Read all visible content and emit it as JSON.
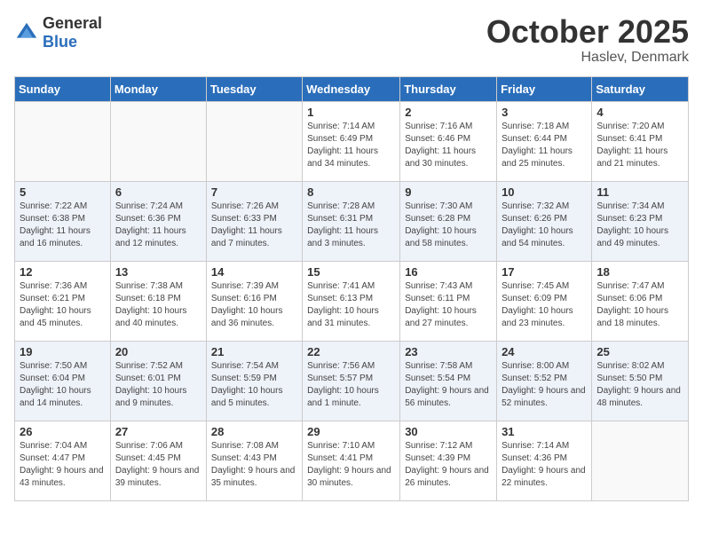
{
  "logo": {
    "text_general": "General",
    "text_blue": "Blue"
  },
  "header": {
    "month": "October 2025",
    "location": "Haslev, Denmark"
  },
  "weekdays": [
    "Sunday",
    "Monday",
    "Tuesday",
    "Wednesday",
    "Thursday",
    "Friday",
    "Saturday"
  ],
  "weeks": [
    [
      {
        "day": "",
        "sunrise": "",
        "sunset": "",
        "daylight": ""
      },
      {
        "day": "",
        "sunrise": "",
        "sunset": "",
        "daylight": ""
      },
      {
        "day": "",
        "sunrise": "",
        "sunset": "",
        "daylight": ""
      },
      {
        "day": "1",
        "sunrise": "Sunrise: 7:14 AM",
        "sunset": "Sunset: 6:49 PM",
        "daylight": "Daylight: 11 hours and 34 minutes."
      },
      {
        "day": "2",
        "sunrise": "Sunrise: 7:16 AM",
        "sunset": "Sunset: 6:46 PM",
        "daylight": "Daylight: 11 hours and 30 minutes."
      },
      {
        "day": "3",
        "sunrise": "Sunrise: 7:18 AM",
        "sunset": "Sunset: 6:44 PM",
        "daylight": "Daylight: 11 hours and 25 minutes."
      },
      {
        "day": "4",
        "sunrise": "Sunrise: 7:20 AM",
        "sunset": "Sunset: 6:41 PM",
        "daylight": "Daylight: 11 hours and 21 minutes."
      }
    ],
    [
      {
        "day": "5",
        "sunrise": "Sunrise: 7:22 AM",
        "sunset": "Sunset: 6:38 PM",
        "daylight": "Daylight: 11 hours and 16 minutes."
      },
      {
        "day": "6",
        "sunrise": "Sunrise: 7:24 AM",
        "sunset": "Sunset: 6:36 PM",
        "daylight": "Daylight: 11 hours and 12 minutes."
      },
      {
        "day": "7",
        "sunrise": "Sunrise: 7:26 AM",
        "sunset": "Sunset: 6:33 PM",
        "daylight": "Daylight: 11 hours and 7 minutes."
      },
      {
        "day": "8",
        "sunrise": "Sunrise: 7:28 AM",
        "sunset": "Sunset: 6:31 PM",
        "daylight": "Daylight: 11 hours and 3 minutes."
      },
      {
        "day": "9",
        "sunrise": "Sunrise: 7:30 AM",
        "sunset": "Sunset: 6:28 PM",
        "daylight": "Daylight: 10 hours and 58 minutes."
      },
      {
        "day": "10",
        "sunrise": "Sunrise: 7:32 AM",
        "sunset": "Sunset: 6:26 PM",
        "daylight": "Daylight: 10 hours and 54 minutes."
      },
      {
        "day": "11",
        "sunrise": "Sunrise: 7:34 AM",
        "sunset": "Sunset: 6:23 PM",
        "daylight": "Daylight: 10 hours and 49 minutes."
      }
    ],
    [
      {
        "day": "12",
        "sunrise": "Sunrise: 7:36 AM",
        "sunset": "Sunset: 6:21 PM",
        "daylight": "Daylight: 10 hours and 45 minutes."
      },
      {
        "day": "13",
        "sunrise": "Sunrise: 7:38 AM",
        "sunset": "Sunset: 6:18 PM",
        "daylight": "Daylight: 10 hours and 40 minutes."
      },
      {
        "day": "14",
        "sunrise": "Sunrise: 7:39 AM",
        "sunset": "Sunset: 6:16 PM",
        "daylight": "Daylight: 10 hours and 36 minutes."
      },
      {
        "day": "15",
        "sunrise": "Sunrise: 7:41 AM",
        "sunset": "Sunset: 6:13 PM",
        "daylight": "Daylight: 10 hours and 31 minutes."
      },
      {
        "day": "16",
        "sunrise": "Sunrise: 7:43 AM",
        "sunset": "Sunset: 6:11 PM",
        "daylight": "Daylight: 10 hours and 27 minutes."
      },
      {
        "day": "17",
        "sunrise": "Sunrise: 7:45 AM",
        "sunset": "Sunset: 6:09 PM",
        "daylight": "Daylight: 10 hours and 23 minutes."
      },
      {
        "day": "18",
        "sunrise": "Sunrise: 7:47 AM",
        "sunset": "Sunset: 6:06 PM",
        "daylight": "Daylight: 10 hours and 18 minutes."
      }
    ],
    [
      {
        "day": "19",
        "sunrise": "Sunrise: 7:50 AM",
        "sunset": "Sunset: 6:04 PM",
        "daylight": "Daylight: 10 hours and 14 minutes."
      },
      {
        "day": "20",
        "sunrise": "Sunrise: 7:52 AM",
        "sunset": "Sunset: 6:01 PM",
        "daylight": "Daylight: 10 hours and 9 minutes."
      },
      {
        "day": "21",
        "sunrise": "Sunrise: 7:54 AM",
        "sunset": "Sunset: 5:59 PM",
        "daylight": "Daylight: 10 hours and 5 minutes."
      },
      {
        "day": "22",
        "sunrise": "Sunrise: 7:56 AM",
        "sunset": "Sunset: 5:57 PM",
        "daylight": "Daylight: 10 hours and 1 minute."
      },
      {
        "day": "23",
        "sunrise": "Sunrise: 7:58 AM",
        "sunset": "Sunset: 5:54 PM",
        "daylight": "Daylight: 9 hours and 56 minutes."
      },
      {
        "day": "24",
        "sunrise": "Sunrise: 8:00 AM",
        "sunset": "Sunset: 5:52 PM",
        "daylight": "Daylight: 9 hours and 52 minutes."
      },
      {
        "day": "25",
        "sunrise": "Sunrise: 8:02 AM",
        "sunset": "Sunset: 5:50 PM",
        "daylight": "Daylight: 9 hours and 48 minutes."
      }
    ],
    [
      {
        "day": "26",
        "sunrise": "Sunrise: 7:04 AM",
        "sunset": "Sunset: 4:47 PM",
        "daylight": "Daylight: 9 hours and 43 minutes."
      },
      {
        "day": "27",
        "sunrise": "Sunrise: 7:06 AM",
        "sunset": "Sunset: 4:45 PM",
        "daylight": "Daylight: 9 hours and 39 minutes."
      },
      {
        "day": "28",
        "sunrise": "Sunrise: 7:08 AM",
        "sunset": "Sunset: 4:43 PM",
        "daylight": "Daylight: 9 hours and 35 minutes."
      },
      {
        "day": "29",
        "sunrise": "Sunrise: 7:10 AM",
        "sunset": "Sunset: 4:41 PM",
        "daylight": "Daylight: 9 hours and 30 minutes."
      },
      {
        "day": "30",
        "sunrise": "Sunrise: 7:12 AM",
        "sunset": "Sunset: 4:39 PM",
        "daylight": "Daylight: 9 hours and 26 minutes."
      },
      {
        "day": "31",
        "sunrise": "Sunrise: 7:14 AM",
        "sunset": "Sunset: 4:36 PM",
        "daylight": "Daylight: 9 hours and 22 minutes."
      },
      {
        "day": "",
        "sunrise": "",
        "sunset": "",
        "daylight": ""
      }
    ]
  ]
}
